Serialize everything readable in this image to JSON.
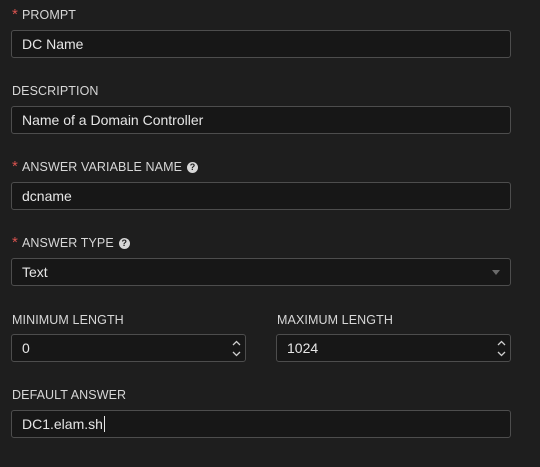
{
  "prompt": {
    "label": "PROMPT",
    "required_mark": "*",
    "value": "DC Name"
  },
  "description": {
    "label": "DESCRIPTION",
    "value": "Name of a Domain Controller"
  },
  "answer_variable_name": {
    "label": "ANSWER VARIABLE NAME",
    "required_mark": "*",
    "help_glyph": "?",
    "value": "dcname"
  },
  "answer_type": {
    "label": "ANSWER TYPE",
    "required_mark": "*",
    "help_glyph": "?",
    "selected": "Text"
  },
  "minimum_length": {
    "label": "MINIMUM LENGTH",
    "value": "0"
  },
  "maximum_length": {
    "label": "MAXIMUM LENGTH",
    "value": "1024"
  },
  "default_answer": {
    "label": "DEFAULT ANSWER",
    "value": "DC1.elam.sh"
  },
  "icons": {
    "help": "question-circle-icon",
    "dropdown": "caret-down-icon",
    "spin_up": "chevron-up-icon",
    "spin_down": "chevron-down-icon"
  },
  "colors": {
    "background": "#1e1e1e",
    "input_background": "#171717",
    "input_border": "#4d4d4d",
    "required": "#d9534f",
    "label": "#d7d7d7",
    "text": "#e6e6e6"
  }
}
